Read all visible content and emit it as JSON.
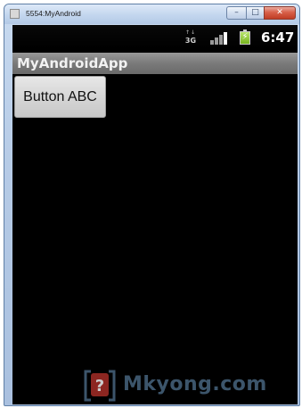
{
  "window": {
    "title": "5554:MyAndroid",
    "controls": {
      "minimize": "–",
      "maximize": "□",
      "close": "✕"
    }
  },
  "statusbar": {
    "network_label": "3G",
    "network_arrows": "↑↓",
    "signal_bars": 4,
    "battery_state": "charging",
    "time": "6:47"
  },
  "app": {
    "title": "MyAndroidApp",
    "button_label": "Button ABC"
  },
  "watermark": {
    "text": "Mkyong.com"
  },
  "colors": {
    "screen_background": "#000000",
    "appbar": "#7a7a7a",
    "battery_fill": "#77b51e",
    "watermark": "#4b6b86"
  }
}
